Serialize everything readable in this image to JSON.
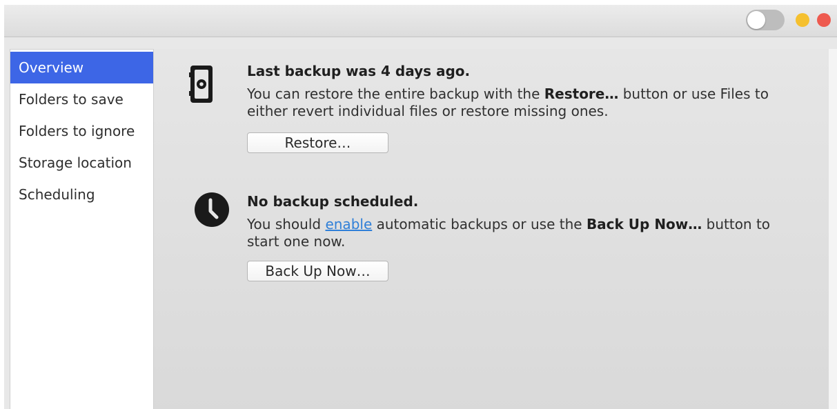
{
  "window": {
    "toggle_state": "off",
    "controls": {
      "minimize_color": "#f5c02f",
      "close_color": "#ee5a4f"
    }
  },
  "sidebar": {
    "items": [
      {
        "label": "Overview",
        "selected": true
      },
      {
        "label": "Folders to save",
        "selected": false
      },
      {
        "label": "Folders to ignore",
        "selected": false
      },
      {
        "label": "Storage location",
        "selected": false
      },
      {
        "label": "Scheduling",
        "selected": false
      }
    ]
  },
  "overview": {
    "backup": {
      "icon": "safe-icon",
      "heading": "Last backup was 4 days ago.",
      "text_1": "You can restore the entire backup with the ",
      "text_bold": "Restore…",
      "text_2": " button or use Files to either revert individual files or restore missing ones.",
      "button_label": "Restore…"
    },
    "schedule": {
      "icon": "clock-icon",
      "heading": "No backup scheduled.",
      "text_1": "You should ",
      "link_label": "enable",
      "text_2": " automatic backups or use the ",
      "text_bold": "Back Up Now…",
      "text_3": " button to start one now.",
      "button_label": "Back Up Now…"
    }
  },
  "colors": {
    "selection": "#3d66e6",
    "link": "#2f7fd8"
  }
}
